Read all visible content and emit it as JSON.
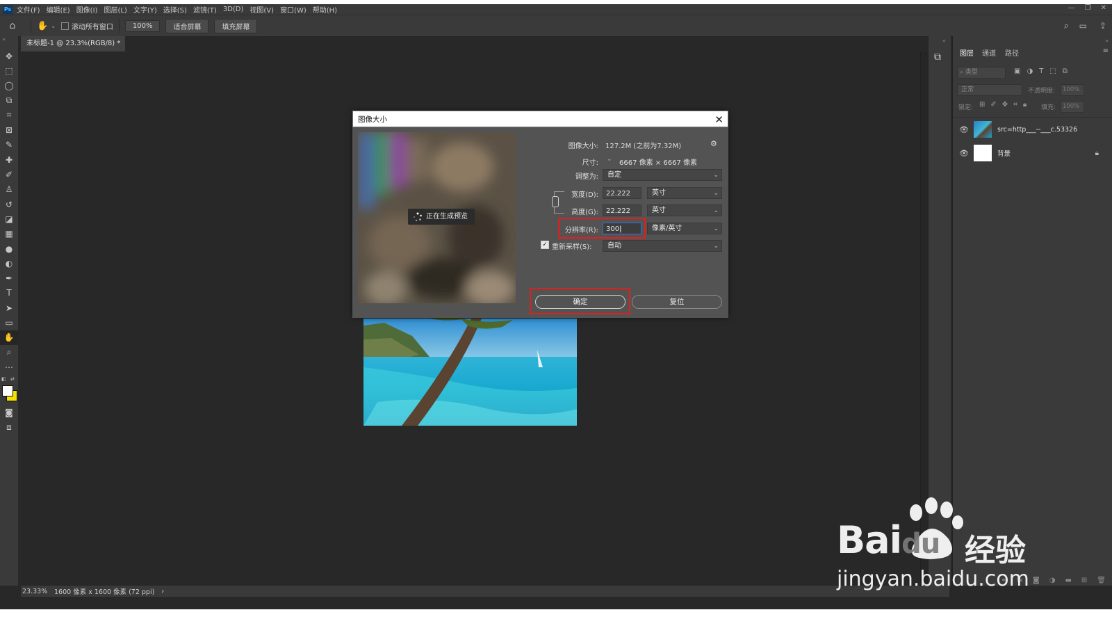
{
  "menubar": {
    "logo": "Ps",
    "items": [
      "文件(F)",
      "编辑(E)",
      "图像(I)",
      "图层(L)",
      "文字(Y)",
      "选择(S)",
      "滤镜(T)",
      "3D(D)",
      "视图(V)",
      "窗口(W)",
      "帮助(H)"
    ]
  },
  "options": {
    "scroll_all": "滚动所有窗口",
    "zoom": "100%",
    "fit_screen": "适合屏幕",
    "fill_screen": "填充屏幕"
  },
  "document": {
    "tab": "未标题-1 @ 23.3%(RGB/8) *",
    "close": "×"
  },
  "status": {
    "zoom": "23.33%",
    "info": "1600 像素 x 1600 像素 (72 ppi)",
    "arrow": "›"
  },
  "dialog": {
    "title": "图像大小",
    "preview_text": "正在生成预览",
    "size_label": "图像大小:",
    "size_value": "127.2M (之前为7.32M)",
    "dim_label": "尺寸:",
    "dim_value": "6667 像素 × 6667 像素",
    "fit_label": "调整为:",
    "fit_value": "自定",
    "width_label": "宽度(D):",
    "width_value": "22.222",
    "width_unit": "英寸",
    "height_label": "高度(G):",
    "height_value": "22.222",
    "height_unit": "英寸",
    "res_label": "分辨率(R):",
    "res_value": "300",
    "res_unit": "像素/英寸",
    "resample_label": "重新采样(S):",
    "resample_value": "自动",
    "resample_checked": true,
    "ok": "确定",
    "reset": "复位"
  },
  "layers_panel": {
    "tabs": [
      "图层",
      "通道",
      "路径"
    ],
    "search_placeholder": "类型",
    "blend_mode": "正常",
    "opacity_label": "不透明度:",
    "opacity_value": "100%",
    "lock_label": "锁定:",
    "fill_label": "填充:",
    "fill_value": "100%",
    "layers": [
      {
        "name": "src=http___--___c.53326"
      },
      {
        "name": "背景"
      }
    ]
  },
  "watermark": {
    "brand": "Bai",
    "brand2": "du",
    "cn": "经验",
    "url": "jingyan.baidu.com"
  },
  "colors": {
    "app_bg": "#282828",
    "panel_bg": "#3a3a3a",
    "dialog_bg": "#535353",
    "highlight_red": "#e0201f",
    "focus_blue": "#2d78d6"
  }
}
